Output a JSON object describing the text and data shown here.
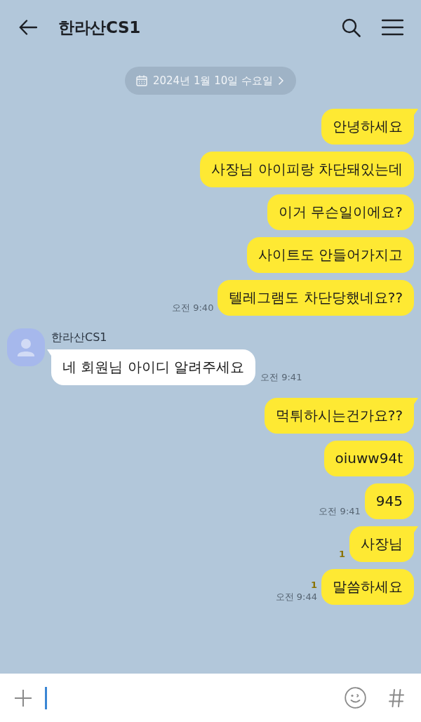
{
  "header": {
    "title": "한라산CS1"
  },
  "date_divider": {
    "text": "2024년 1월 10일 수요일"
  },
  "messages": [
    {
      "kind": "sent",
      "text": "안녕하세요",
      "tail": true
    },
    {
      "kind": "sent",
      "text": "사장님 아이피랑 차단돼있는데",
      "tail": false
    },
    {
      "kind": "sent",
      "text": "이거 무슨일이에요?",
      "tail": false
    },
    {
      "kind": "sent",
      "text": "사이트도 안들어가지고",
      "tail": false
    },
    {
      "kind": "sent",
      "text": "텔레그램도 차단당했네요??",
      "tail": false,
      "time": "오전 9:40"
    },
    {
      "kind": "received",
      "sender": "한라산CS1",
      "text": "네 회원님 아이디 알려주세요",
      "tail": true,
      "time": "오전 9:41"
    },
    {
      "kind": "sent",
      "text": "먹튀하시는건가요??",
      "tail": true
    },
    {
      "kind": "sent",
      "text": "oiuww94t",
      "tail": false
    },
    {
      "kind": "sent",
      "text": "945",
      "tail": false,
      "time": "오전 9:41"
    },
    {
      "kind": "sent",
      "text": "사장님",
      "tail": true,
      "unread": "1"
    },
    {
      "kind": "sent",
      "text": "말씀하세요",
      "tail": false,
      "unread": "1",
      "time": "오전 9:44"
    }
  ],
  "composer": {
    "focused": true
  }
}
